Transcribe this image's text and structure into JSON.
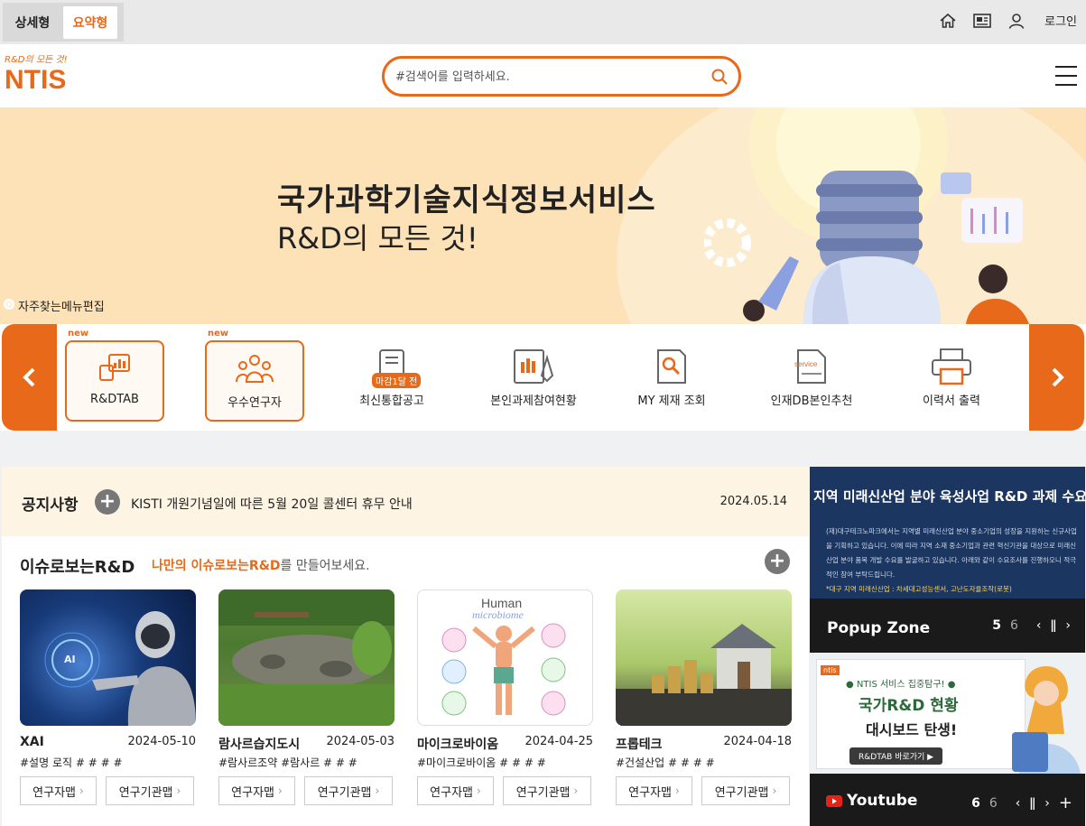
{
  "top_bar": {
    "view_tabs": [
      "상세형",
      "요약형"
    ],
    "active_view": "요약형",
    "icons": [
      "home-icon",
      "newspaper-icon",
      "user-icon"
    ],
    "login_label": "로그인"
  },
  "header": {
    "logo_tagline": "R&D의 모든 것!",
    "logo_name": "NTIS",
    "search_placeholder": "#검색어를 입력하세요."
  },
  "banner": {
    "title": "국가과학기술지식정보서비스",
    "subtitle": "R&D의 모든 것!",
    "favorites_edit_label": "자주찾는메뉴편집"
  },
  "quick_menu": {
    "items": [
      {
        "label": "R&DTAB",
        "new_label": "new",
        "icon": "chart-board-icon"
      },
      {
        "label": "우수연구자",
        "new_label": "new",
        "icon": "researchers-icon"
      },
      {
        "label": "최신통합공고",
        "badge": "마감1달 전",
        "icon": "notice-doc-icon"
      },
      {
        "label": "본인과제참여현황",
        "icon": "project-chart-icon"
      },
      {
        "label": "MY 제재 조회",
        "icon": "search-doc-icon"
      },
      {
        "label": "인재DB본인추천",
        "badge": "service",
        "icon": "service-doc-icon"
      },
      {
        "label": "이력서 출력",
        "icon": "printer-icon"
      }
    ]
  },
  "notice": {
    "label": "공지사항",
    "text": "KISTI 개원기념일에 따른 5월 20일 콜센터 휴무 안내",
    "date": "2024.05.14"
  },
  "issue": {
    "title": "이슈로보는R&D",
    "subtitle_highlight": "나만의 이슈로보는R&D",
    "subtitle_rest": "를 만들어보세요.",
    "cards": [
      {
        "title": "XAI",
        "date": "2024-05-10",
        "tags": "#설명 로직 # # # #",
        "btn1": "연구자맵",
        "btn2": "연구기관맵",
        "thumb_text": "AI"
      },
      {
        "title": "람사르습지도시",
        "date": "2024-05-03",
        "tags": "#람사르조약 #람사르 # # #",
        "btn1": "연구자맵",
        "btn2": "연구기관맵"
      },
      {
        "title": "마이크로바이옴",
        "date": "2024-04-25",
        "tags": "#마이크로바이옴 # # # #",
        "btn1": "연구자맵",
        "btn2": "연구기관맵",
        "thumb_text": "Human",
        "thumb_text2": "microbiome"
      },
      {
        "title": "프롭테크",
        "date": "2024-04-18",
        "tags": "#건설산업 # # # #",
        "btn1": "연구자맵",
        "btn2": "연구기관맵"
      }
    ]
  },
  "popup": {
    "image_title": "지역 미래신산업 분야 육성사업 R&D 과제 수요조사 공고",
    "image_body": "(재)대구테크노파크에서는 지역별 미래신산업 분야 중소기업의 성장을 지원하는 신규사업을 기획하고 있습니다. 이에 따라 지역 소재 중소기업과 관련 혁신기관을 대상으로 미래신산업 분야 품목 개발 수요를 발굴하고 있습니다. 아래와 같이 수요조사를 진행하오니 적극적인 참여 부탁드립니다.",
    "image_note": "*대구 지역 미래신산업 : 차세대고성능센서, 고난도자율조작(로봇)",
    "label": "Popup Zone",
    "current": "5",
    "total": "6"
  },
  "dashboard_ad": {
    "line1": "● NTIS 서비스 집중탐구! ●",
    "line2": "국가R&D 현황",
    "line3": "대시보드 탄생!",
    "button": "R&DTAB 바로가기 ▶",
    "logo": "ntis"
  },
  "youtube": {
    "label": "Youtube",
    "current": "6",
    "total": "6"
  },
  "colors": {
    "accent": "#e8691a",
    "banner_bg": "#fde2b8",
    "dark_bar": "#1a1a1a"
  }
}
